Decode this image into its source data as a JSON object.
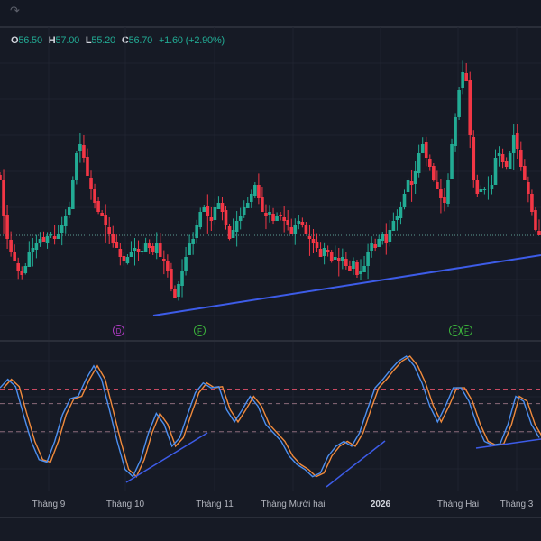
{
  "toolbar": {
    "redo_icon": "redo-arrow-icon"
  },
  "legend": {
    "o_label": "O",
    "o_value": "56.50",
    "h_label": "H",
    "h_value": "57.00",
    "l_label": "L",
    "l_value": "55.20",
    "c_label": "C",
    "c_value": "56.70",
    "change": "+1.60 (+2.90%)"
  },
  "colors": {
    "up": "#22ab94",
    "down": "#f23645",
    "k_line": "#4c8ff0",
    "d_line": "#f08a3c",
    "trendline": "#3d5ce8",
    "level": "#c84a62",
    "background": "#161a25"
  },
  "events": [
    {
      "label": "D",
      "kind": "dividend"
    },
    {
      "label": "F",
      "kind": "financials"
    },
    {
      "label": "F",
      "kind": "financials"
    },
    {
      "label": "F",
      "kind": "financials"
    }
  ],
  "chart_data": [
    {
      "type": "candlestick",
      "title": "Price",
      "last_price": 56.7,
      "closes": [
        59.75,
        57.75,
        56.5,
        55.75,
        55.25,
        54.75,
        54.5,
        55.0,
        55.75,
        56.0,
        56.25,
        56.5,
        56.35,
        56.65,
        56.75,
        56.5,
        56.75,
        57.25,
        57.75,
        58.25,
        59.75,
        61.25,
        61.75,
        61.0,
        60.0,
        59.25,
        58.5,
        58.0,
        57.75,
        57.25,
        56.75,
        56.25,
        56.0,
        55.5,
        55.25,
        55.5,
        55.75,
        56.0,
        55.75,
        55.85,
        56.25,
        56.0,
        55.75,
        56.25,
        55.5,
        55.25,
        54.75,
        53.75,
        53.25,
        54.0,
        54.75,
        55.5,
        56.25,
        56.5,
        57.25,
        58.0,
        58.25,
        57.75,
        57.5,
        58.25,
        58.5,
        58.0,
        57.25,
        56.5,
        57.0,
        57.5,
        57.75,
        58.25,
        58.5,
        59.0,
        59.5,
        58.75,
        58.0,
        57.75,
        58.0,
        57.5,
        57.75,
        57.75,
        57.5,
        57.25,
        56.75,
        57.25,
        57.5,
        57.25,
        56.75,
        56.5,
        56.25,
        56.0,
        55.5,
        56.0,
        55.75,
        55.25,
        55.5,
        55.25,
        55.5,
        55.0,
        54.75,
        55.25,
        54.5,
        54.75,
        55.0,
        55.75,
        56.25,
        56.0,
        56.5,
        56.75,
        56.25,
        57.0,
        57.5,
        57.75,
        58.25,
        59.0,
        59.75,
        59.5,
        60.25,
        61.25,
        61.75,
        61.0,
        60.5,
        59.75,
        59.25,
        58.75,
        58.5,
        59.75,
        61.75,
        63.25,
        64.75,
        65.75,
        65.25,
        62.25,
        59.75,
        59.0,
        59.25,
        59.25,
        59.35,
        59.5,
        61.0,
        61.25,
        60.75,
        60.5,
        61.25,
        62.25,
        61.5,
        60.5,
        59.75,
        59.0,
        58.0,
        57.0,
        56.7
      ]
    },
    {
      "type": "line",
      "title": "Oscillator",
      "ylim": [
        0,
        100
      ],
      "levels": [
        73,
        61,
        50,
        38,
        27
      ],
      "series": [
        {
          "name": "K",
          "values": [
            74,
            81,
            75,
            52,
            30,
            15,
            13,
            30,
            52,
            65,
            67,
            81,
            92,
            81,
            56,
            30,
            7,
            1,
            15,
            37,
            53,
            44,
            26,
            33,
            52,
            70,
            78,
            74,
            75,
            56,
            46,
            56,
            67,
            59,
            44,
            37,
            30,
            18,
            11,
            7,
            1,
            4,
            18,
            26,
            30,
            26,
            37,
            56,
            74,
            81,
            89,
            96,
            100,
            92,
            78,
            59,
            46,
            59,
            74,
            74,
            63,
            44,
            30,
            27,
            28,
            44,
            67,
            63,
            44,
            33
          ]
        }
      ]
    }
  ],
  "time_axis": [
    "Tháng 9",
    "Tháng 10",
    "Tháng 11",
    "Tháng Mười hai",
    "2026",
    "Tháng Hai",
    "Tháng 3"
  ]
}
